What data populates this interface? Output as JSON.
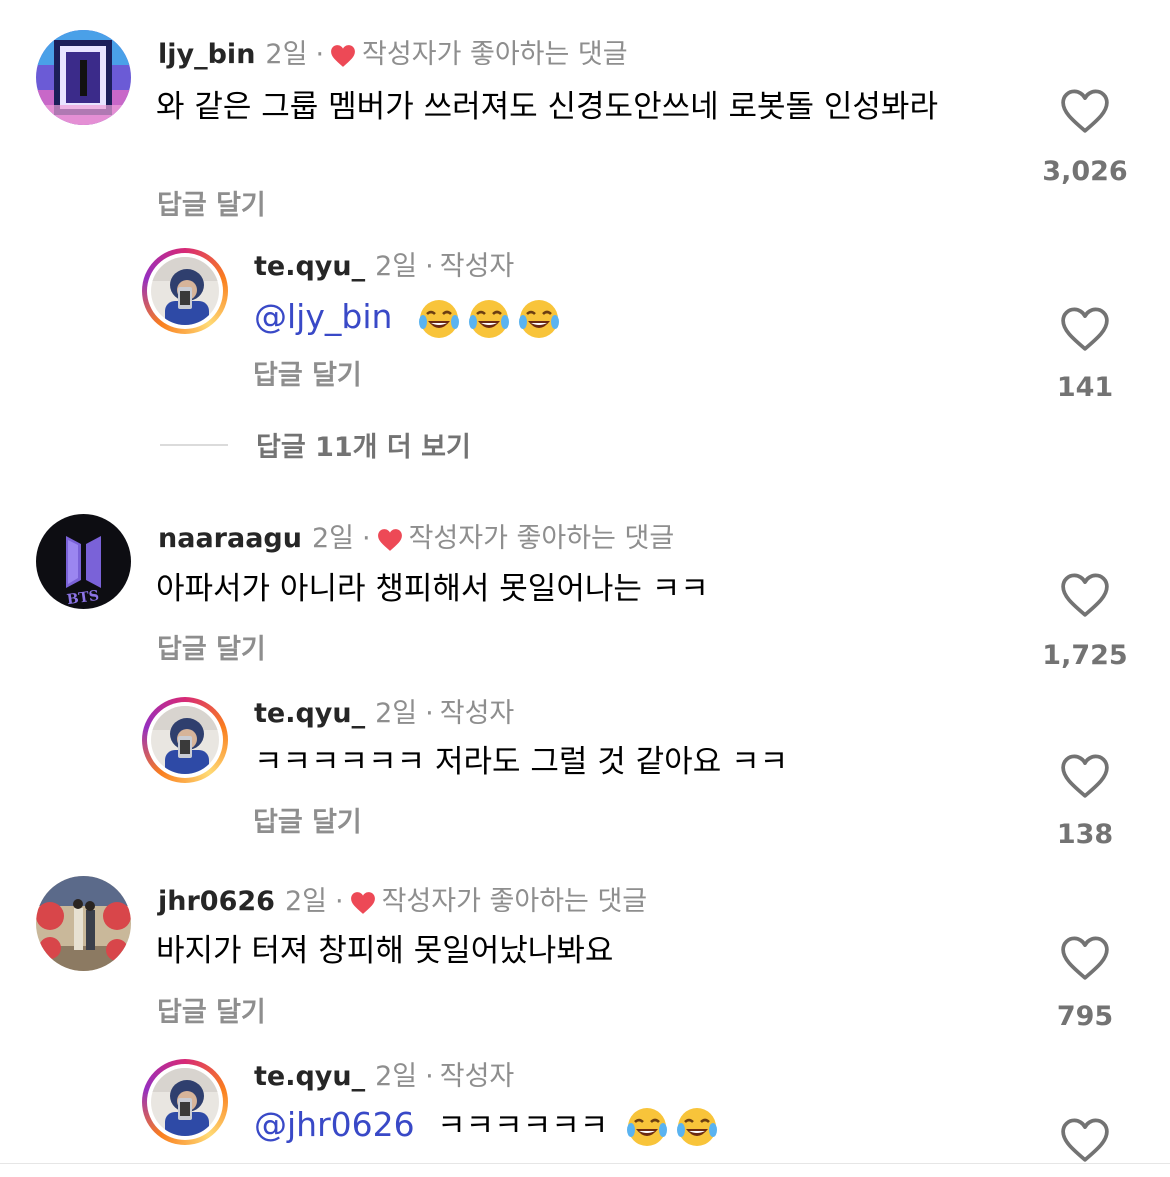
{
  "comments": [
    {
      "username": "ljy_bin",
      "time": "2일",
      "dot": "·",
      "tag": "작성자가 좋아하는 댓글",
      "text": "와 같은 그룹 멤버가 쓰러져도 신경도안쓰네 로봇돌 인성봐라",
      "reply_label": "답글 달기",
      "likes": "3,026",
      "replies": [
        {
          "username": "te.qyu_",
          "time": "2일",
          "dot": "·",
          "tag": "작성자",
          "mention": "@ljy_bin",
          "text": "",
          "emoji_count": 3,
          "reply_label": "답글 달기",
          "likes": "141"
        }
      ],
      "view_more": "답글 11개 더 보기"
    },
    {
      "username": "naaraagu",
      "time": "2일",
      "dot": "·",
      "tag": "작성자가 좋아하는 댓글",
      "text": "아파서가 아니라 챙피해서 못일어나는 ㅋㅋ",
      "reply_label": "답글 달기",
      "likes": "1,725",
      "avatar_text": "BTS",
      "replies": [
        {
          "username": "te.qyu_",
          "time": "2일",
          "dot": "·",
          "tag": "작성자",
          "text": "ㅋㅋㅋㅋㅋㅋ 저라도 그럴 것 같아요 ㅋㅋ",
          "reply_label": "답글 달기",
          "likes": "138"
        }
      ]
    },
    {
      "username": "jhr0626",
      "time": "2일",
      "dot": "·",
      "tag": "작성자가 좋아하는 댓글",
      "text": "바지가 터져 창피해 못일어났나봐요",
      "reply_label": "답글 달기",
      "likes": "795",
      "replies": [
        {
          "username": "te.qyu_",
          "time": "2일",
          "dot": "·",
          "tag": "작성자",
          "mention": "@jhr0626",
          "text": "ㅋㅋㅋㅋㅋㅋ",
          "emoji_count": 2,
          "likes": ""
        }
      ]
    }
  ],
  "colors": {
    "heart_badge": "#ed4956",
    "mention": "#3949c7",
    "secondary": "#8e8e8e"
  }
}
